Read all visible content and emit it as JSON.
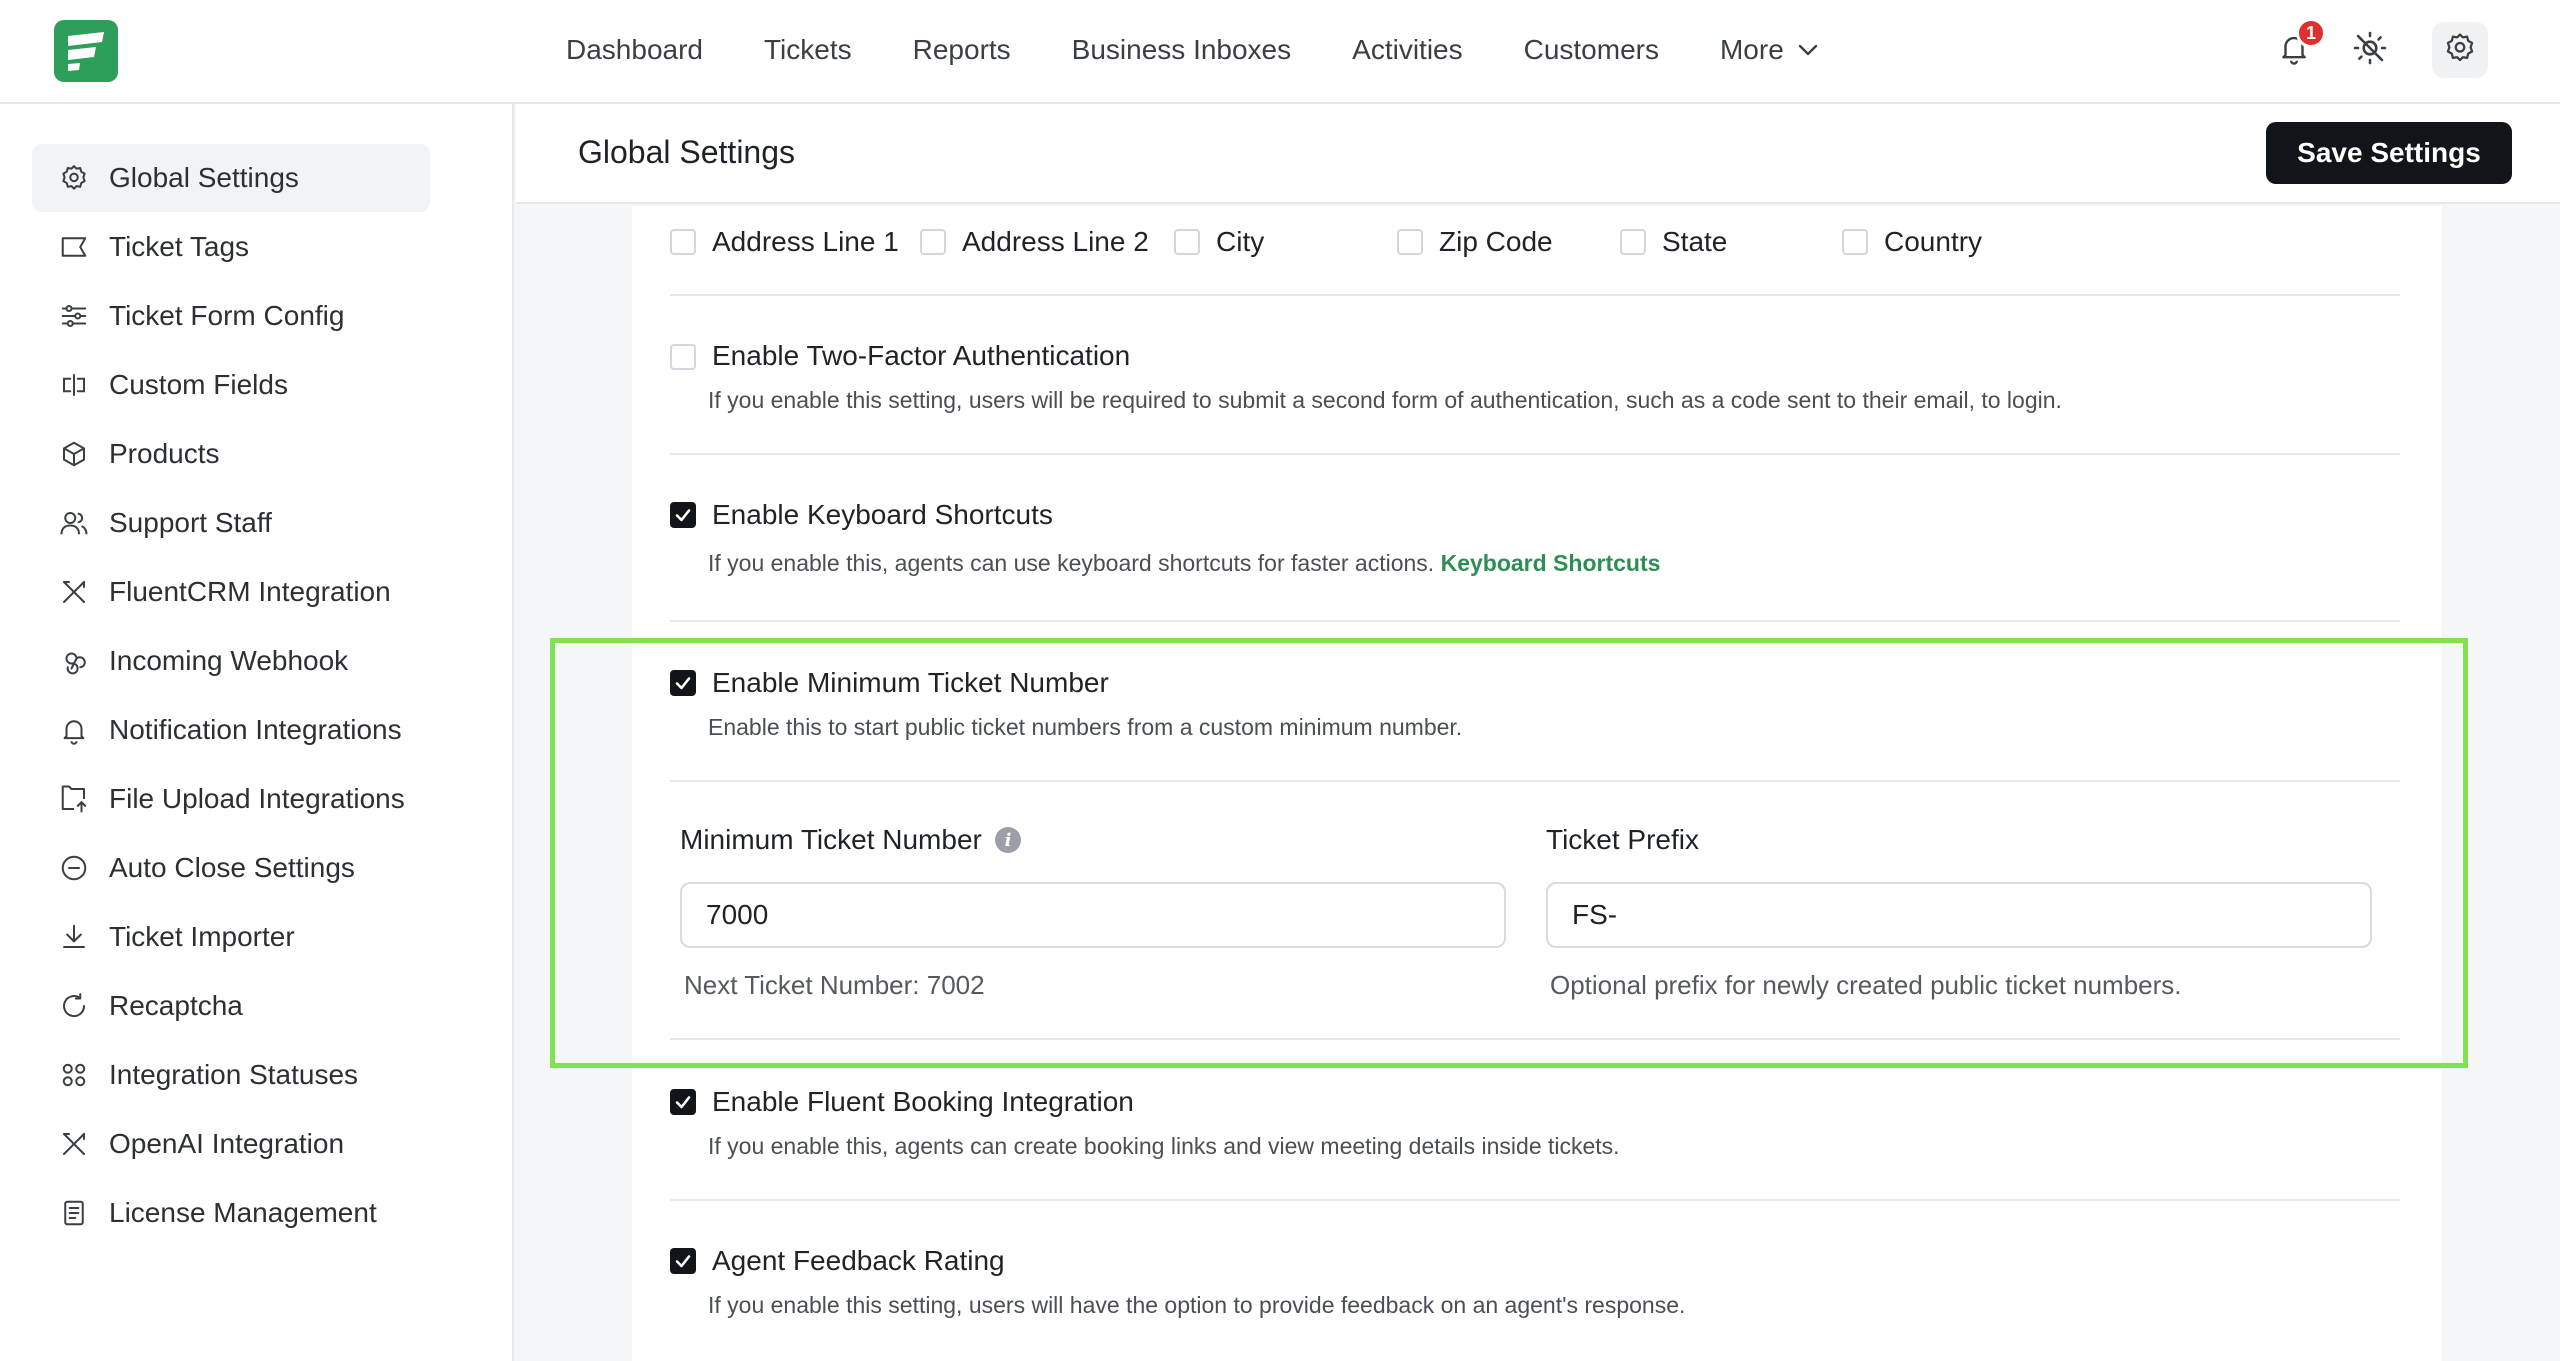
{
  "nav": {
    "items": [
      "Dashboard",
      "Tickets",
      "Reports",
      "Business Inboxes",
      "Activities",
      "Customers"
    ],
    "more_label": "More",
    "notification_count": "1"
  },
  "sidebar": {
    "items": [
      {
        "label": "Global Settings",
        "icon": "gear-icon"
      },
      {
        "label": "Ticket Tags",
        "icon": "tag-icon"
      },
      {
        "label": "Ticket Form Config",
        "icon": "sliders-icon"
      },
      {
        "label": "Custom Fields",
        "icon": "custom-field-icon"
      },
      {
        "label": "Products",
        "icon": "box-icon"
      },
      {
        "label": "Support Staff",
        "icon": "users-icon"
      },
      {
        "label": "FluentCRM Integration",
        "icon": "crm-icon"
      },
      {
        "label": "Incoming Webhook",
        "icon": "webhook-icon"
      },
      {
        "label": "Notification Integrations",
        "icon": "bell-icon"
      },
      {
        "label": "File Upload Integrations",
        "icon": "upload-icon"
      },
      {
        "label": "Auto Close Settings",
        "icon": "minus-circle-icon"
      },
      {
        "label": "Ticket Importer",
        "icon": "download-icon"
      },
      {
        "label": "Recaptcha",
        "icon": "refresh-icon"
      },
      {
        "label": "Integration Statuses",
        "icon": "grid-icon"
      },
      {
        "label": "OpenAI Integration",
        "icon": "ai-icon"
      },
      {
        "label": "License Management",
        "icon": "document-icon"
      }
    ]
  },
  "header": {
    "title": "Global Settings",
    "save_label": "Save Settings"
  },
  "address_fields": [
    "Address Line 1",
    "Address Line 2",
    "City",
    "Zip Code",
    "State",
    "Country"
  ],
  "settings": {
    "two_factor": {
      "label": "Enable Two-Factor Authentication",
      "desc": "If you enable this setting, users will be required to submit a second form of authentication, such as a code sent to their email, to login.",
      "checked": false
    },
    "keyboard": {
      "label": "Enable Keyboard Shortcuts",
      "desc": "If you enable this, agents can use keyboard shortcuts for faster actions.",
      "link": "Keyboard Shortcuts",
      "checked": true
    },
    "min_ticket": {
      "label": "Enable Minimum Ticket Number",
      "desc": "Enable this to start public ticket numbers from a custom minimum number.",
      "checked": true,
      "number_label": "Minimum Ticket Number",
      "number_value": "7000",
      "next_number": "Next Ticket Number: 7002",
      "prefix_label": "Ticket Prefix",
      "prefix_value": "FS-",
      "prefix_help": "Optional prefix for newly created public ticket numbers."
    },
    "booking": {
      "label": "Enable Fluent Booking Integration",
      "desc": "If you enable this, agents can create booking links and view meeting details inside tickets.",
      "checked": true
    },
    "feedback": {
      "label": "Agent Feedback Rating",
      "desc": "If you enable this setting, users will have the option to provide feedback on an agent's response.",
      "checked": true
    }
  },
  "colors": {
    "brand": "#2e9f5b",
    "link": "#2e8f55",
    "highlight": "#7ee34f",
    "badge": "#e02f2f"
  }
}
